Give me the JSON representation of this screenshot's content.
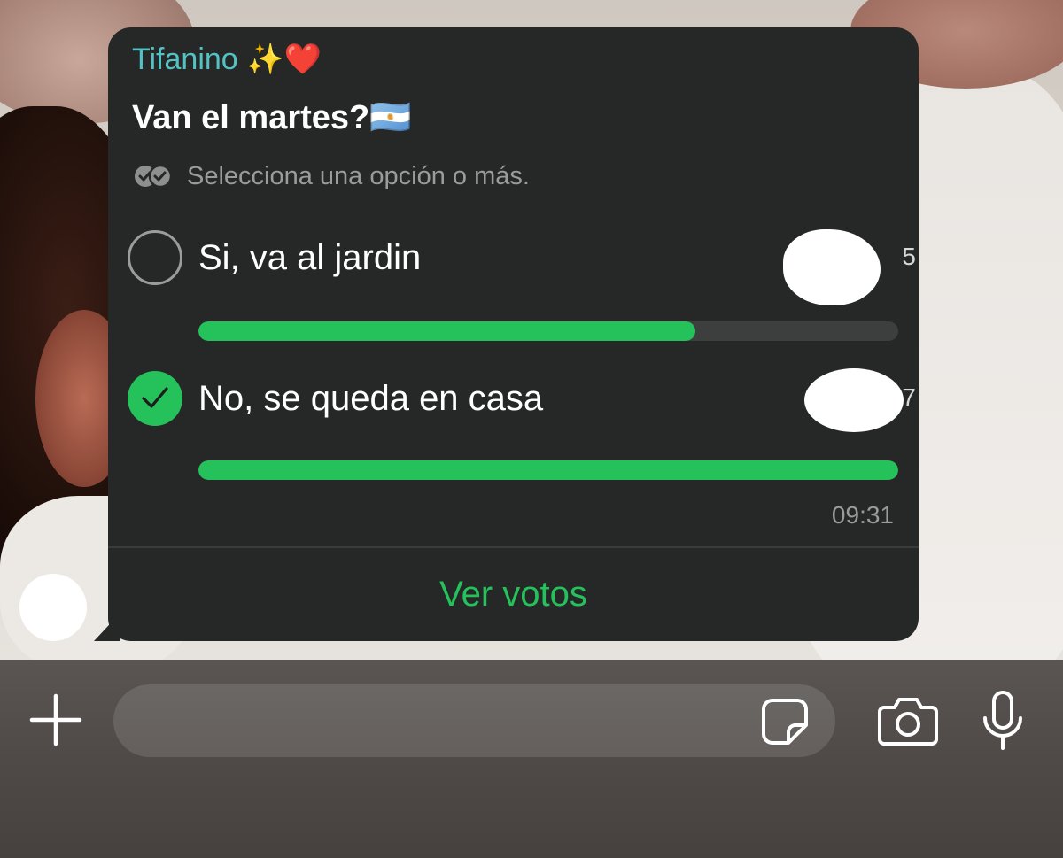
{
  "chat": {
    "sender_name": "Tifanino ✨❤️",
    "poll": {
      "question": "Van el martes?🇦🇷",
      "hint": "Selecciona una opción o más.",
      "options": [
        {
          "label": "Si, va al jardin",
          "votes": "5",
          "fraction": 0.71,
          "selected": false
        },
        {
          "label": "No, se queda en casa",
          "votes": "7",
          "fraction": 1.0,
          "selected": true
        }
      ],
      "time": "09:31",
      "view_votes_label": "Ver votos"
    }
  },
  "composer": {
    "message_value": "",
    "icons": {
      "attach": "plus-icon",
      "sticker": "sticker-icon",
      "camera": "camera-icon",
      "microphone": "microphone-icon"
    }
  },
  "colors": {
    "accent_green": "#25c15b",
    "sender_teal": "#52c2c4",
    "bubble": "#262827"
  }
}
